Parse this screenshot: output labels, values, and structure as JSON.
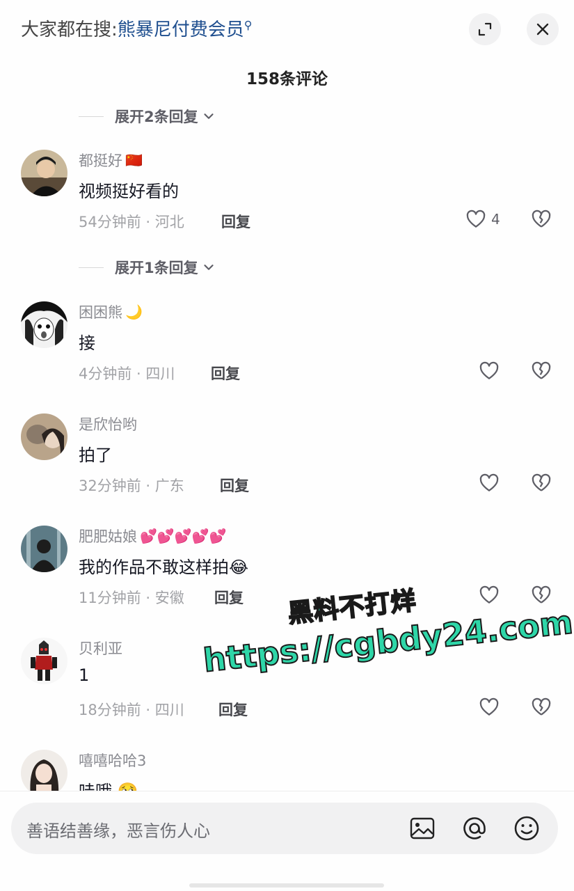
{
  "header": {
    "search_prefix": "大家都在搜:",
    "search_keyword": "熊暴尼付费会员",
    "comment_count_title": "158条评论"
  },
  "expand_top": {
    "label": "展开2条回复"
  },
  "expand_mid": {
    "label": "展开1条回复"
  },
  "comments": [
    {
      "username": "都挺好",
      "badge": "🇨🇳",
      "text": "视频挺好看的",
      "time_location": "54分钟前 · 河北",
      "reply_label": "回复",
      "likes": "4"
    },
    {
      "username": "困困熊",
      "badge": "🌙",
      "text": "接",
      "time_location": "4分钟前 · 四川",
      "reply_label": "回复",
      "likes": ""
    },
    {
      "username": "是欣怡哟",
      "badge": "",
      "text": "拍了",
      "time_location": "32分钟前 · 广东",
      "reply_label": "回复",
      "likes": ""
    },
    {
      "username": "肥肥姑娘",
      "badge": "💕💕💕💕💕",
      "text": "我的作品不敢这样拍😂",
      "time_location": "11分钟前 · 安徽",
      "reply_label": "回复",
      "likes": ""
    },
    {
      "username": "贝利亚",
      "badge": "",
      "text": "1",
      "time_location": "18分钟前 · 四川",
      "reply_label": "回复",
      "likes": ""
    },
    {
      "username": "嘻嘻哈哈3",
      "badge": "",
      "text": "哇哦 🥺",
      "time_location": "",
      "reply_label": "",
      "likes": ""
    }
  ],
  "watermark": {
    "line1": "黑料不打烊",
    "line2": "https://cgbdy24.com"
  },
  "input": {
    "placeholder": "善语结善缘，恶言伤人心"
  },
  "icons": {
    "expand": "expand-icon",
    "close": "close-icon",
    "chevron": "chevron-down-icon",
    "like": "heart-icon",
    "dislike": "broken-heart-icon",
    "image": "image-icon",
    "mention": "at-icon",
    "emoji": "smiley-icon"
  },
  "colors": {
    "keyword_blue": "#1f4f8f",
    "watermark_green": "#2ed6a8"
  }
}
